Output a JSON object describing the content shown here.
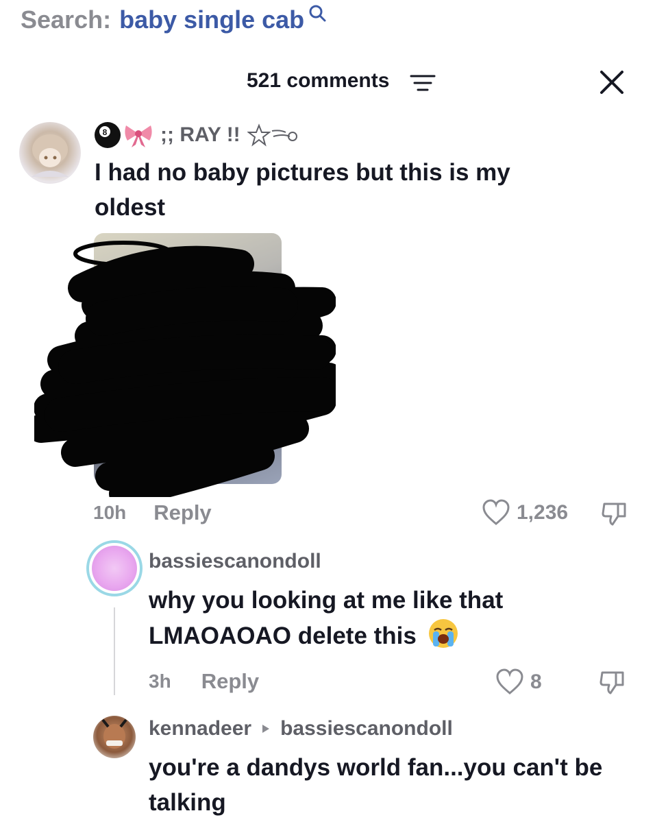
{
  "search": {
    "label": "Search:",
    "query": "baby single cab",
    "icon": "search-icon"
  },
  "header": {
    "comments_count": "521 comments",
    "sort_icon": "sort-icon",
    "close_icon": "close-icon"
  },
  "comments": [
    {
      "username": ";; RAY !!",
      "emoji_prefix": [
        "8-ball",
        "ribbon"
      ],
      "emoji_suffix": [
        "star-outline",
        "dash"
      ],
      "text": "I had no baby pictures but this is my oldest",
      "has_photo": true,
      "time": "10h",
      "reply_label": "Reply",
      "likes": "1,236"
    },
    {
      "username": "bassiescanondoll",
      "text": "why you looking at me like that LMAOAOAO delete this",
      "emoji_suffix": "loudly-crying-face",
      "time": "3h",
      "reply_label": "Reply",
      "likes": "8"
    },
    {
      "username": "kennadeer",
      "reply_to": "bassiescanondoll",
      "text": "you're a dandys world fan...you can't be talking"
    }
  ],
  "colors": {
    "accent_link": "#3c5aa6",
    "muted": "#8a8b91",
    "text": "#161823"
  }
}
